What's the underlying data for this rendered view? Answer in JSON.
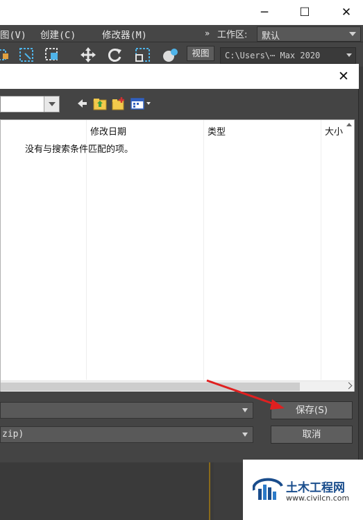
{
  "window": {
    "controls": {
      "minimize": "─",
      "maximize": "☐",
      "close": "✕"
    }
  },
  "menubar": {
    "items": [
      "图(V)",
      "创建(C)",
      "修改器(M)"
    ],
    "overflow_icon": "»",
    "workspace_label": "工作区:",
    "workspace_value": "默认"
  },
  "toolbar": {
    "icons": [
      "select-region-icon",
      "select-window-icon",
      "select-crossing-icon",
      "move-icon",
      "rotate-icon",
      "scale-icon",
      "view-cube-icon"
    ],
    "view_button": "视图",
    "project_path": "C:\\Users\\⋯ Max 2020"
  },
  "dialog": {
    "close_icon": "✕",
    "lookin_value": "",
    "nav_icons": [
      "back-arrow-icon",
      "up-folder-icon",
      "new-folder-icon",
      "view-menu-icon"
    ],
    "columns": [
      "修改日期",
      "类型",
      "大小"
    ],
    "empty_message": "没有与搜索条件匹配的项。",
    "filename_value": "",
    "filetype_value": "zip)",
    "save_button": "保存(S)",
    "cancel_button": "取消"
  },
  "watermark": {
    "title": "土木工程网",
    "url": "www.civilcn.com"
  },
  "colors": {
    "app_bg": "#444444",
    "annotation_arrow": "#e02020",
    "accent_line": "#8a6b1a",
    "watermark_blue": "#1a4d8c"
  }
}
